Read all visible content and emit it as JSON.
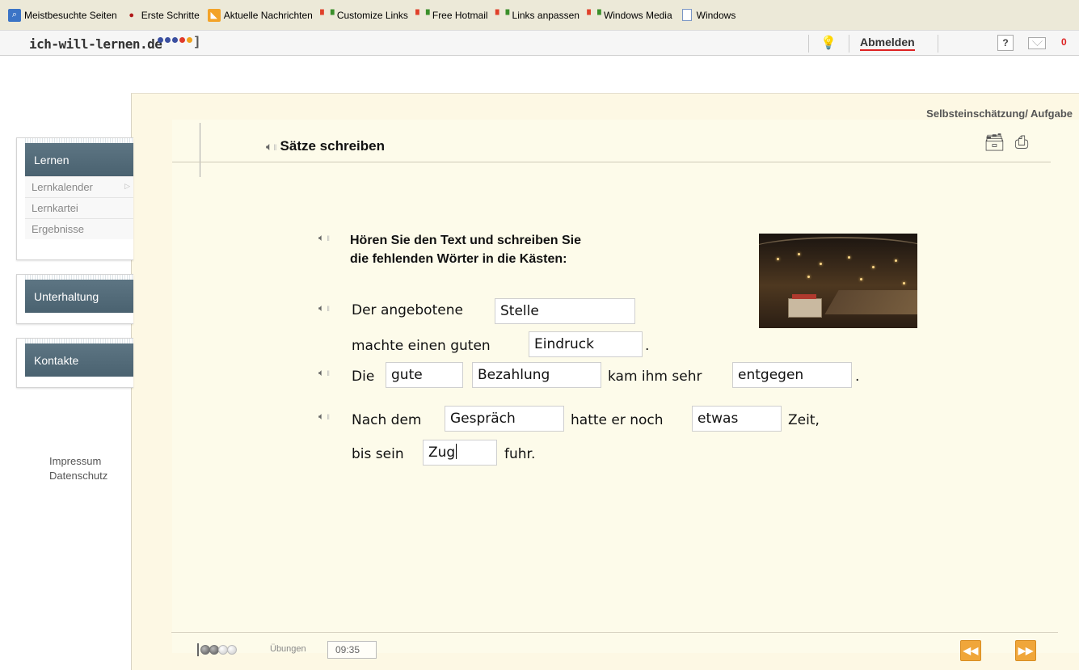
{
  "bookmarks": [
    {
      "label": "Meistbesuchte Seiten",
      "icon": "search-icon"
    },
    {
      "label": "Erste Schritte",
      "icon": "firefox-icon"
    },
    {
      "label": "Aktuelle Nachrichten",
      "icon": "rss-icon"
    },
    {
      "label": "Customize Links",
      "icon": "windows-icon"
    },
    {
      "label": "Free Hotmail",
      "icon": "windows-icon"
    },
    {
      "label": "Links anpassen",
      "icon": "windows-icon"
    },
    {
      "label": "Windows Media",
      "icon": "windows-icon"
    },
    {
      "label": "Windows",
      "icon": "page-icon"
    }
  ],
  "header": {
    "logo": "ich-will-lernen.de",
    "logo_bracket": "]",
    "logo_dot_colors": [
      "#3a4fa0",
      "#3a4fa0",
      "#3a4fa0",
      "#e03a2a",
      "#f0a21b"
    ],
    "logout": "Abmelden",
    "help": "?",
    "mail_count": "0"
  },
  "breadcrumb": "Selbsteinschätzung/ Aufgabe",
  "title": "Sätze schreiben",
  "sidebar": {
    "lernen": {
      "label": "Lernen",
      "items": [
        "Lernkalender",
        "Lernkartei",
        "Ergebnisse"
      ]
    },
    "unterhaltung": {
      "label": "Unterhaltung"
    },
    "kontakte": {
      "label": "Kontakte"
    },
    "footer": [
      "Impressum",
      "Datenschutz"
    ]
  },
  "exercise": {
    "instruction_line1": "Hören Sie den Text und schreiben Sie",
    "instruction_line2": "die fehlenden Wörter in die Kästen:",
    "s1_text1": "Der angebotene",
    "s1_gap1": "Stelle",
    "s1_text2": "machte einen guten",
    "s1_gap2": "Eindruck",
    "s1_end": ".",
    "s2_text1": "Die",
    "s2_gap1": "gute",
    "s2_gap2": "Bezahlung",
    "s2_text2": "kam ihm sehr",
    "s2_gap3": "entgegen",
    "s2_end": ".",
    "s3_text1": "Nach dem",
    "s3_gap1": "Gespräch",
    "s3_text2": "hatte er noch",
    "s3_gap2": "etwas",
    "s3_text3": "Zeit,",
    "s3_text4": "bis sein",
    "s3_gap3": "Zug",
    "s3_text5": "fuhr."
  },
  "bottom": {
    "progress_label": "Übungen",
    "progress_done": 2,
    "progress_total": 4,
    "time": "09:35",
    "prev": "◀◀",
    "next": "▶▶"
  },
  "colors": {
    "nav_header": "#4f6775",
    "accent_orange": "#f0a63a",
    "panel_bg": "#fdf8e4"
  }
}
